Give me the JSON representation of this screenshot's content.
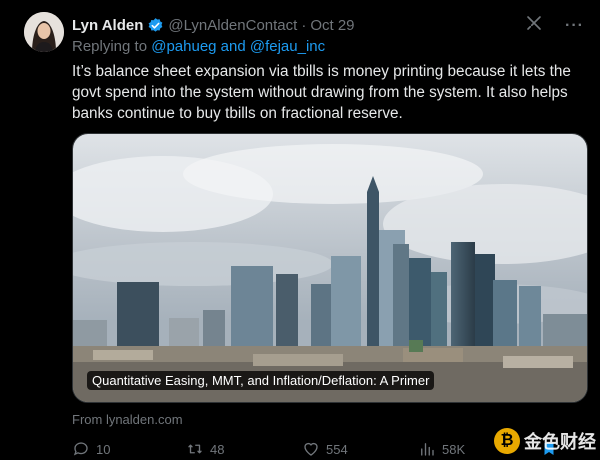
{
  "author": {
    "name": "Lyn Alden",
    "handle": "@LynAldenContact",
    "date": "Oct 29"
  },
  "reply": {
    "prefix": "Replying to",
    "mentions": "@pahueg and @fejau_inc"
  },
  "text": "It’s balance sheet expansion via tbills is money printing because it lets the govt spend into the system without drawing from the system. It also helps banks continue to buy tbills on fractional reserve.",
  "card": {
    "title": "Quantitative Easing, MMT, and Inflation/Deflation: A Primer",
    "source": "From lynalden.com"
  },
  "actions": {
    "replies": "10",
    "reposts": "48",
    "likes": "554",
    "views": "58K"
  },
  "watermark": {
    "text": "金色财经",
    "logo_char": "₿"
  },
  "colors": {
    "background": "#000000",
    "text": "#e7e9ea",
    "muted": "#71767b",
    "link": "#1d9bf0"
  },
  "icons": [
    "verified-badge-icon",
    "grok-icon",
    "more-icon",
    "reply-icon",
    "repost-icon",
    "like-icon",
    "views-icon",
    "bookmark-icon",
    "share-icon"
  ]
}
